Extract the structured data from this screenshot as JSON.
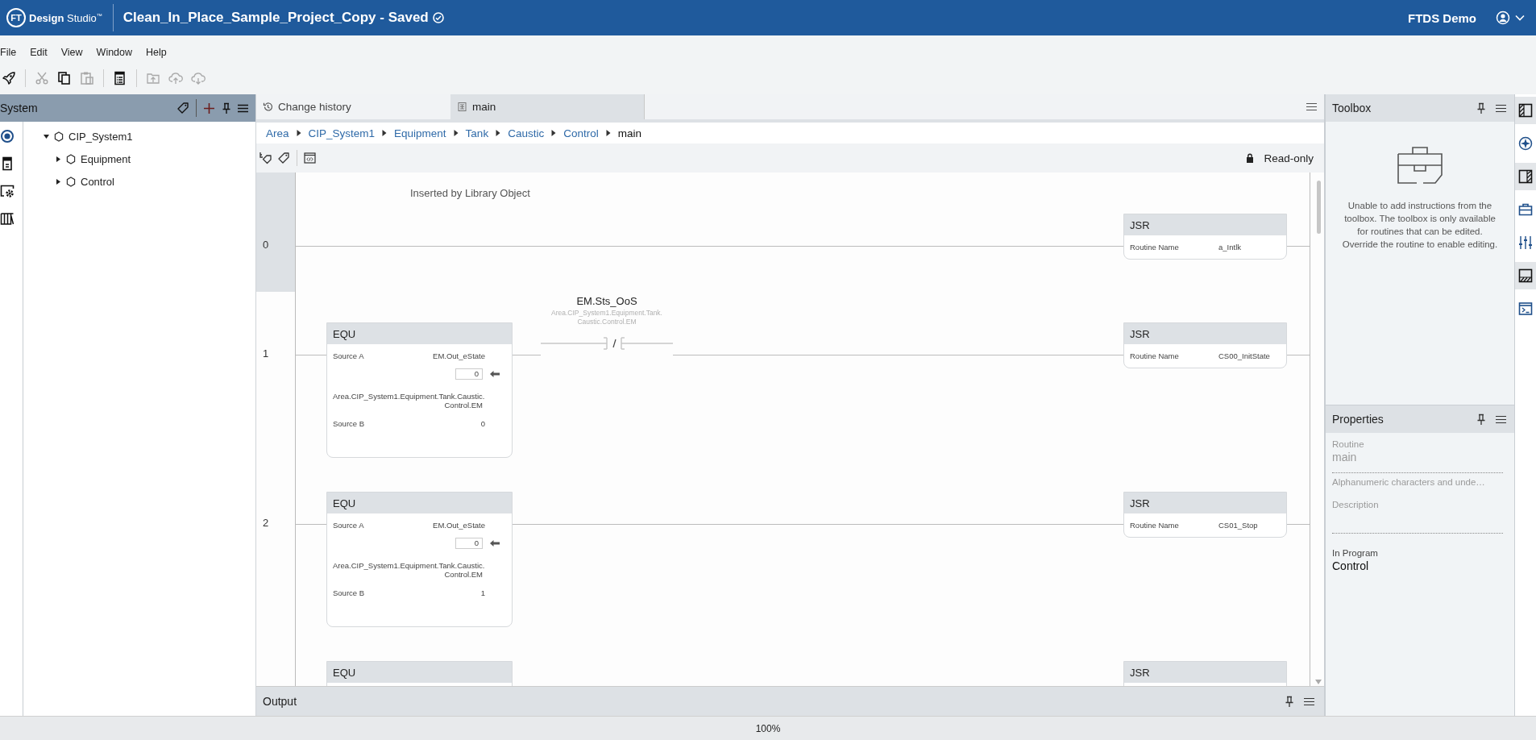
{
  "app": {
    "logo_mark": "FT",
    "logo_text": "**Design** Studio$^{™}$",
    "project_title": "Clean_In_Place_Sample_Project_Copy - Saved",
    "saved": true,
    "user": "FTDS Demo"
  },
  "menu": [
    "File",
    "Edit",
    "View",
    "Window",
    "Help"
  ],
  "toolbar": [
    {
      "disabled": false
    },
    {
      "disabled": true
    },
    {
      "disabled": false
    },
    {
      "disabled": true
    },
    {
      "disabled": false
    },
    {
      "disabled": true
    },
    {
      "disabled": true
    },
    {
      "disabled": true
    }
  ],
  "left_strip": [
    {
      "selected": true
    },
    {
      "selected": false
    },
    {
      "selected": false
    },
    {
      "selected": false
    }
  ],
  "system_panel": {
    "title": "System",
    "tree": [
      {
        "label": "CIP_System1",
        "expanded": true,
        "children": [
          {
            "label": "Equipment",
            "expanded": false
          },
          {
            "label": "Control",
            "expanded": false
          }
        ]
      }
    ]
  },
  "editor": {
    "tabs": [
      {
        "label": "Change history",
        "selected": false
      },
      {
        "label": "main",
        "selected": true
      }
    ],
    "breadcrumb": [
      "Area",
      "CIP_System1",
      "Equipment",
      "Tank",
      "Caustic",
      "Control",
      "main"
    ],
    "mode": "Read-only",
    "rungs": [
      {
        "number": "0",
        "selected": true,
        "comment": "Inserted by Library Object",
        "elements": [
          {
            "kind": "jsr",
            "title": "JSR",
            "param_label": "Routine Name",
            "param_value": "a_Intlk"
          }
        ]
      },
      {
        "number": "1",
        "selected": false,
        "elements": [
          {
            "kind": "equ",
            "title": "EQU",
            "source_a_label": "Source A",
            "source_a": "EM.Out_eState",
            "source_a_value": "0",
            "path_lines": [
              "Area.CIP_System1.Equipment.Tank.Caustic.",
              "Control.EM"
            ],
            "source_b_label": "Source B",
            "source_b": "0"
          },
          {
            "kind": "xio",
            "tag": "EM.Sts_OoS",
            "path_lines": [
              "Area.CIP_System1.Equipment.Tank.",
              "Caustic.Control.EM"
            ]
          },
          {
            "kind": "jsr",
            "title": "JSR",
            "param_label": "Routine Name",
            "param_value": "CS00_InitState"
          }
        ]
      },
      {
        "number": "2",
        "selected": false,
        "elements": [
          {
            "kind": "equ",
            "title": "EQU",
            "source_a_label": "Source A",
            "source_a": "EM.Out_eState",
            "source_a_value": "0",
            "path_lines": [
              "Area.CIP_System1.Equipment.Tank.Caustic.",
              "Control.EM"
            ],
            "source_b_label": "Source B",
            "source_b": "1"
          },
          {
            "kind": "jsr",
            "title": "JSR",
            "param_label": "Routine Name",
            "param_value": "CS01_Stop"
          }
        ]
      },
      {
        "selected": false,
        "elements": [
          {
            "kind": "equ",
            "title": "EQU"
          },
          {
            "kind": "jsr",
            "title": "JSR"
          }
        ]
      }
    ]
  },
  "toolbox": {
    "title": "Toolbox",
    "message": "Unable to add instructions from the toolbox. The toolbox is only available for routines that can be edited. Override the routine to enable editing."
  },
  "properties": {
    "title": "Properties",
    "fields": [
      {
        "kind": "input",
        "label": "Routine",
        "value": "main",
        "hint": "Alphanumeric characters and unde…",
        "disabled": true
      },
      {
        "kind": "input",
        "label": "Description",
        "disabled": true
      },
      {
        "kind": "text",
        "label": "In Program",
        "value": "Control"
      }
    ]
  },
  "right_strip": [
    {
      "selected": true
    },
    {
      "selected": false
    },
    {
      "selected": true
    },
    {
      "selected": false
    },
    {
      "selected": false
    },
    {
      "selected": true
    },
    {
      "selected": false
    }
  ],
  "output": {
    "title": "Output"
  },
  "status_bar": {
    "zoom": "100%"
  }
}
